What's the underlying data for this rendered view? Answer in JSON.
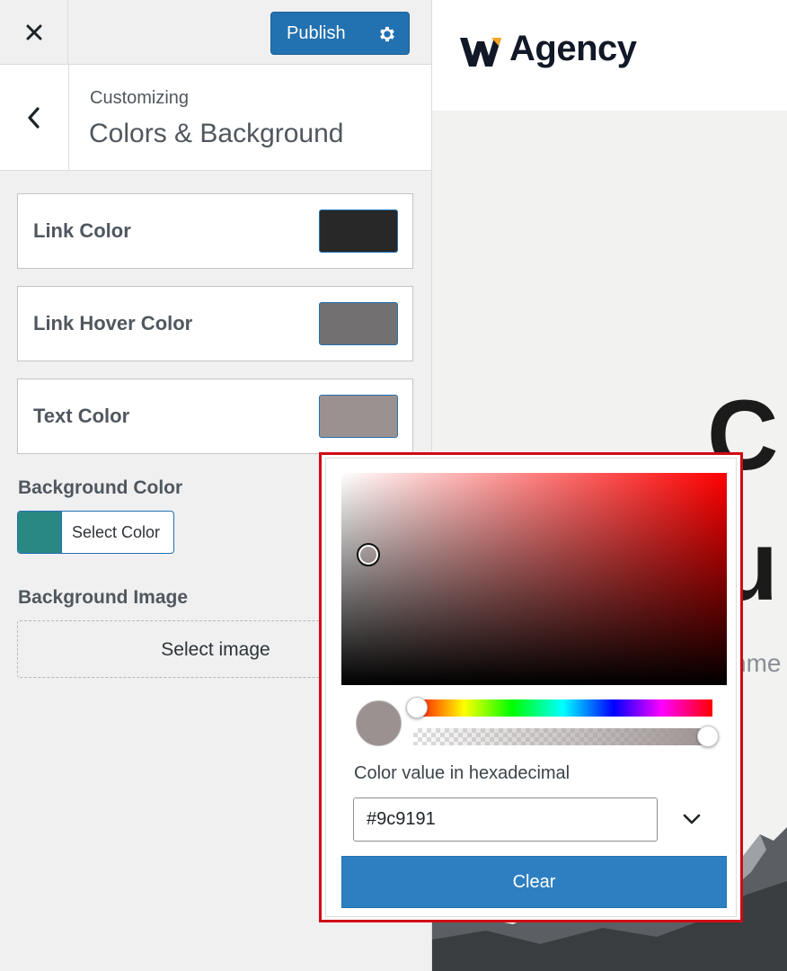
{
  "topbar": {
    "close_icon": "close-icon",
    "publish_label": "Publish",
    "publish_icon": "gear-icon"
  },
  "section": {
    "back_icon": "chevron-left-icon",
    "breadcrumb": "Customizing",
    "title": "Colors & Background"
  },
  "controls": [
    {
      "label": "Link Color",
      "color": "#282828"
    },
    {
      "label": "Link Hover Color",
      "color": "#727070"
    },
    {
      "label": "Text Color",
      "color": "#9c9191"
    }
  ],
  "background_color": {
    "label": "Background Color",
    "swatch_color": "#2a8883",
    "button_label": "Select Color"
  },
  "background_image": {
    "label": "Background Image",
    "button_label": "Select image"
  },
  "preview": {
    "logo_text": "Agency",
    "logo_mark": "W",
    "hero_line_1": "C",
    "hero_line_2": "u",
    "hero_sub": "nme"
  },
  "picker": {
    "hex_label": "Color value in hexadecimal",
    "hex_value": "#9c9191",
    "current_color": "#9c9191",
    "hue_position": 0.0,
    "alpha": 1.0,
    "dropdown_icon": "chevron-down-icon",
    "clear_label": "Clear"
  }
}
